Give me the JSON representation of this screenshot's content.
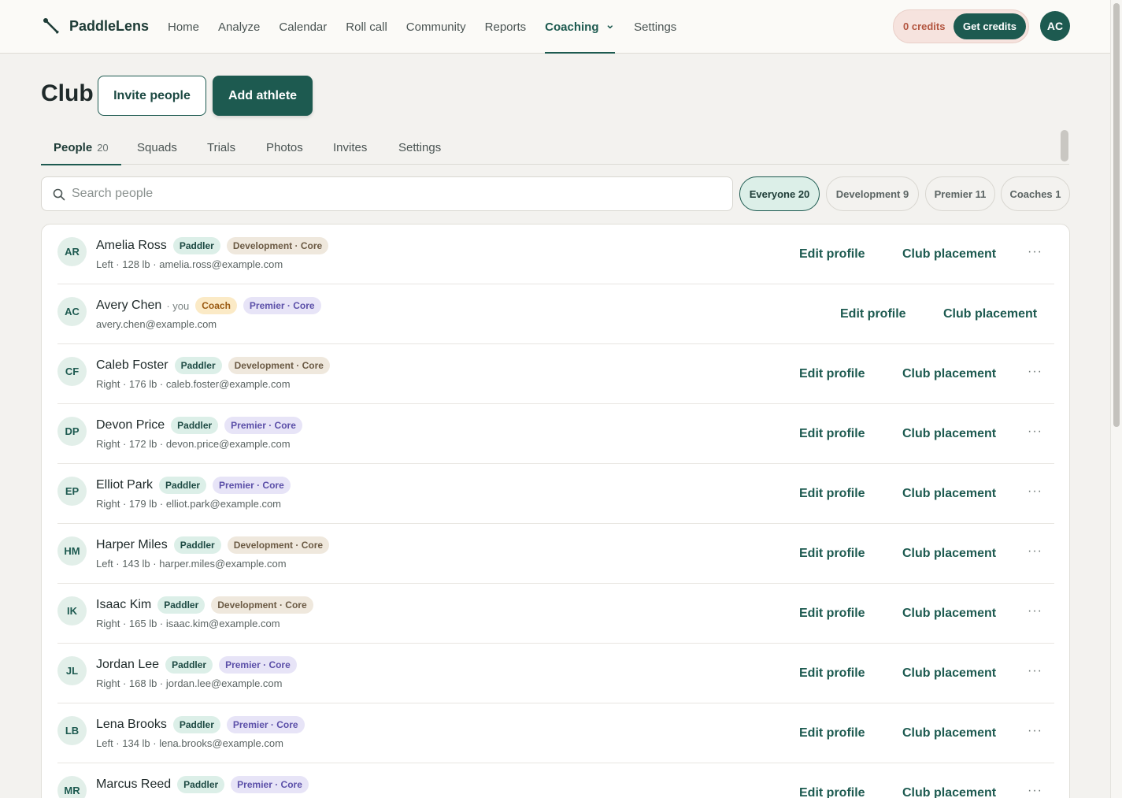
{
  "app": {
    "name": "PaddleLens"
  },
  "nav": [
    "Home",
    "Analyze",
    "Calendar",
    "Roll call",
    "Community",
    "Reports",
    "Coaching",
    "Settings"
  ],
  "nav_active": "Coaching",
  "credits": {
    "label": "0 credits",
    "button": "Get credits"
  },
  "user": {
    "initials": "AC"
  },
  "page": {
    "title": "Club",
    "invite_label": "Invite people",
    "add_label": "Add athlete"
  },
  "tabs": [
    {
      "label": "People",
      "count": "20"
    },
    {
      "label": "Squads"
    },
    {
      "label": "Trials"
    },
    {
      "label": "Photos"
    },
    {
      "label": "Invites"
    },
    {
      "label": "Settings"
    }
  ],
  "search": {
    "placeholder": "Search people"
  },
  "filters": [
    "Everyone 20",
    "Development 9",
    "Premier 11",
    "Coaches 1"
  ],
  "actions": {
    "edit": "Edit profile",
    "placement": "Club placement",
    "more": "···"
  },
  "people": [
    {
      "initials": "AR",
      "name": "Amelia Ross",
      "you": "",
      "role": "Paddler",
      "squad": "Development · Core",
      "sub": "Left · 128 lb · amelia.ross@example.com"
    },
    {
      "initials": "AC",
      "name": "Avery Chen",
      "you": "· you",
      "role": "Coach",
      "squad": "Premier · Core",
      "sub": "avery.chen@example.com"
    },
    {
      "initials": "CF",
      "name": "Caleb Foster",
      "you": "",
      "role": "Paddler",
      "squad": "Development · Core",
      "sub": "Right · 176 lb · caleb.foster@example.com"
    },
    {
      "initials": "DP",
      "name": "Devon Price",
      "you": "",
      "role": "Paddler",
      "squad": "Premier · Core",
      "sub": "Right · 172 lb · devon.price@example.com"
    },
    {
      "initials": "EP",
      "name": "Elliot Park",
      "you": "",
      "role": "Paddler",
      "squad": "Premier · Core",
      "sub": "Right · 179 lb · elliot.park@example.com"
    },
    {
      "initials": "HM",
      "name": "Harper Miles",
      "you": "",
      "role": "Paddler",
      "squad": "Development · Core",
      "sub": "Left · 143 lb · harper.miles@example.com"
    },
    {
      "initials": "IK",
      "name": "Isaac Kim",
      "you": "",
      "role": "Paddler",
      "squad": "Development · Core",
      "sub": "Right · 165 lb · isaac.kim@example.com"
    },
    {
      "initials": "JL",
      "name": "Jordan Lee",
      "you": "",
      "role": "Paddler",
      "squad": "Premier · Core",
      "sub": "Right · 168 lb · jordan.lee@example.com"
    },
    {
      "initials": "LB",
      "name": "Lena Brooks",
      "you": "",
      "role": "Paddler",
      "squad": "Premier · Core",
      "sub": "Left · 134 lb · lena.brooks@example.com"
    },
    {
      "initials": "MR",
      "name": "Marcus Reed",
      "you": "",
      "role": "Paddler",
      "squad": "Premier · Core",
      "sub": ""
    }
  ]
}
